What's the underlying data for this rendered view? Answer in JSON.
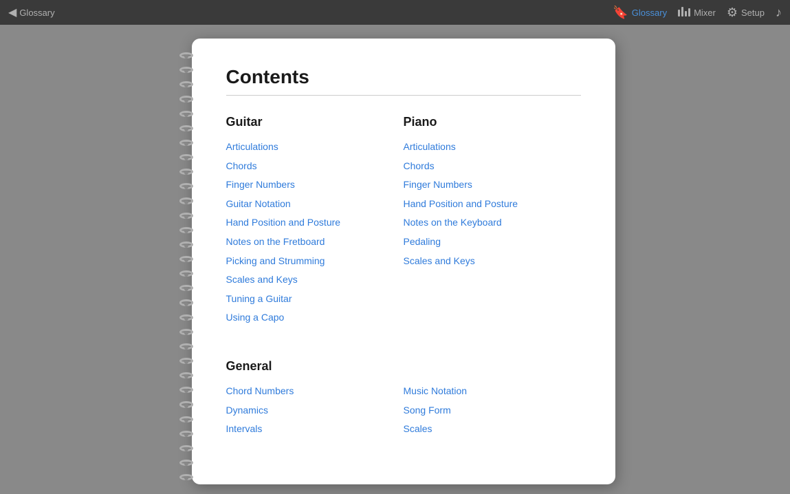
{
  "topbar": {
    "back_label": "Glossary",
    "back_arrow": "◀",
    "nav_items": [
      {
        "id": "glossary",
        "label": "Glossary",
        "icon": "bookmark",
        "active": true
      },
      {
        "id": "mixer",
        "label": "Mixer",
        "icon": "mixer",
        "active": false
      },
      {
        "id": "setup",
        "label": "Setup",
        "icon": "gear",
        "active": false
      },
      {
        "id": "music",
        "label": "",
        "icon": "note",
        "active": false
      }
    ]
  },
  "page": {
    "title": "Contents",
    "sections": {
      "guitar": {
        "heading": "Guitar",
        "links": [
          "Articulations",
          "Chords",
          "Finger Numbers",
          "Guitar Notation",
          "Hand Position and Posture",
          "Notes on the Fretboard",
          "Picking and Strumming",
          "Scales and Keys",
          "Tuning a Guitar",
          "Using a Capo"
        ]
      },
      "piano": {
        "heading": "Piano",
        "links": [
          "Articulations",
          "Chords",
          "Finger Numbers",
          "Hand Position and Posture",
          "Notes on the Keyboard",
          "Pedaling",
          "Scales and Keys"
        ]
      },
      "general": {
        "heading": "General",
        "col1": [
          "Chord Numbers",
          "Dynamics",
          "Intervals"
        ],
        "col2": [
          "Music Notation",
          "Song Form",
          "Scales"
        ]
      }
    }
  },
  "spiral_count": 30
}
